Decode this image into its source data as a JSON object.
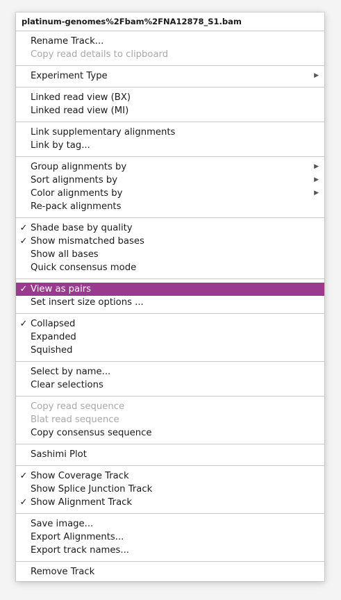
{
  "menu": {
    "title": "platinum-genomes%2Fbam%2FNA12878_S1.bam",
    "sections": [
      {
        "items": [
          {
            "label": "Rename Track..."
          },
          {
            "label": "Copy read details to clipboard",
            "disabled": true
          }
        ]
      },
      {
        "items": [
          {
            "label": "Experiment Type",
            "submenu": true
          }
        ]
      },
      {
        "items": [
          {
            "label": "Linked read view (BX)"
          },
          {
            "label": "Linked read view (MI)"
          }
        ]
      },
      {
        "items": [
          {
            "label": "Link supplementary alignments"
          },
          {
            "label": "Link by tag..."
          }
        ]
      },
      {
        "items": [
          {
            "label": "Group alignments by",
            "submenu": true
          },
          {
            "label": "Sort alignments by",
            "submenu": true
          },
          {
            "label": "Color alignments by",
            "submenu": true
          },
          {
            "label": "Re-pack alignments"
          }
        ]
      },
      {
        "items": [
          {
            "label": "Shade base by quality",
            "checked": true
          },
          {
            "label": "Show mismatched bases",
            "checked": true
          },
          {
            "label": "Show all bases"
          },
          {
            "label": "Quick consensus mode"
          }
        ]
      },
      {
        "items": [
          {
            "label": "View as pairs",
            "checked": true,
            "highlighted": true
          },
          {
            "label": "Set insert size options ..."
          }
        ]
      },
      {
        "items": [
          {
            "label": "Collapsed",
            "checked": true
          },
          {
            "label": "Expanded"
          },
          {
            "label": "Squished"
          }
        ]
      },
      {
        "items": [
          {
            "label": "Select by name..."
          },
          {
            "label": "Clear selections"
          }
        ]
      },
      {
        "items": [
          {
            "label": "Copy read sequence",
            "disabled": true
          },
          {
            "label": "Blat read sequence",
            "disabled": true
          },
          {
            "label": "Copy consensus sequence"
          }
        ]
      },
      {
        "items": [
          {
            "label": "Sashimi Plot"
          }
        ]
      },
      {
        "items": [
          {
            "label": "Show Coverage Track",
            "checked": true
          },
          {
            "label": "Show Splice Junction Track"
          },
          {
            "label": "Show Alignment Track",
            "checked": true
          }
        ]
      },
      {
        "items": [
          {
            "label": "Save image..."
          },
          {
            "label": "Export Alignments..."
          },
          {
            "label": "Export track names..."
          }
        ]
      },
      {
        "items": [
          {
            "label": "Remove Track"
          }
        ]
      }
    ]
  },
  "glyphs": {
    "check": "✓",
    "submenu_arrow": "▶"
  },
  "colors": {
    "highlight": "#9a3a8e",
    "disabled_text": "#a8a8a8",
    "separator": "#c8c8c8"
  }
}
